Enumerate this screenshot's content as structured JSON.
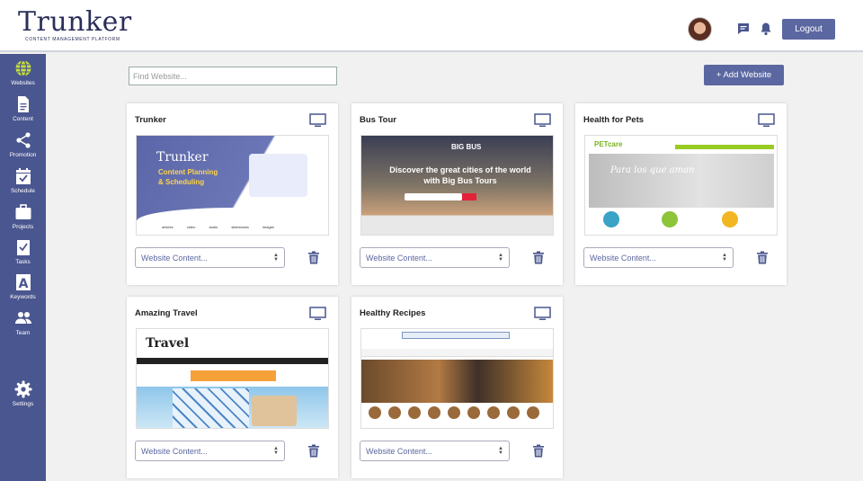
{
  "header": {
    "logo_word": "Trunker",
    "logo_tagline": "CONTENT MANAGEMENT PLATFORM",
    "logout_label": "Logout"
  },
  "sidebar": {
    "items": [
      {
        "label": "Websites",
        "icon": "globe-icon"
      },
      {
        "label": "Content",
        "icon": "document-icon"
      },
      {
        "label": "Promotion",
        "icon": "share-icon"
      },
      {
        "label": "Schedule",
        "icon": "calendar-check-icon"
      },
      {
        "label": "Projects",
        "icon": "briefcase-icon"
      },
      {
        "label": "Tasks",
        "icon": "clipboard-check-icon"
      },
      {
        "label": "Keywords",
        "icon": "letter-a-icon"
      },
      {
        "label": "Team",
        "icon": "people-icon"
      },
      {
        "label": "Settings",
        "icon": "gear-icon"
      }
    ]
  },
  "toolbar": {
    "search_placeholder": "Find Website...",
    "add_label": "+ Add Website"
  },
  "websites": [
    {
      "name": "Trunker",
      "select_placeholder": "Website Content..."
    },
    {
      "name": "Bus Tour",
      "select_placeholder": "Website Content..."
    },
    {
      "name": "Health for Pets",
      "select_placeholder": "Website Content..."
    },
    {
      "name": "Amazing Travel",
      "select_placeholder": "Website Content..."
    },
    {
      "name": "Healthy Recipes",
      "select_placeholder": "Website Content..."
    }
  ],
  "thumbnails": {
    "trunker": {
      "brand": "Trunker",
      "headline_1": "Content Planning",
      "headline_2": "& Scheduling",
      "tabs": "articles video audio slideshows images"
    },
    "bus": {
      "brand": "BIG BUS",
      "headline": "Discover the great cities of the world with Big Bus Tours"
    },
    "pets": {
      "brand": "PETcare",
      "script": "Para los que aman"
    },
    "travel": {
      "brand": "Travel"
    },
    "recipes": {}
  },
  "colors": {
    "sidebar": "#4a568f",
    "button": "#5b67a0",
    "accent_link": "#5b67a0"
  }
}
